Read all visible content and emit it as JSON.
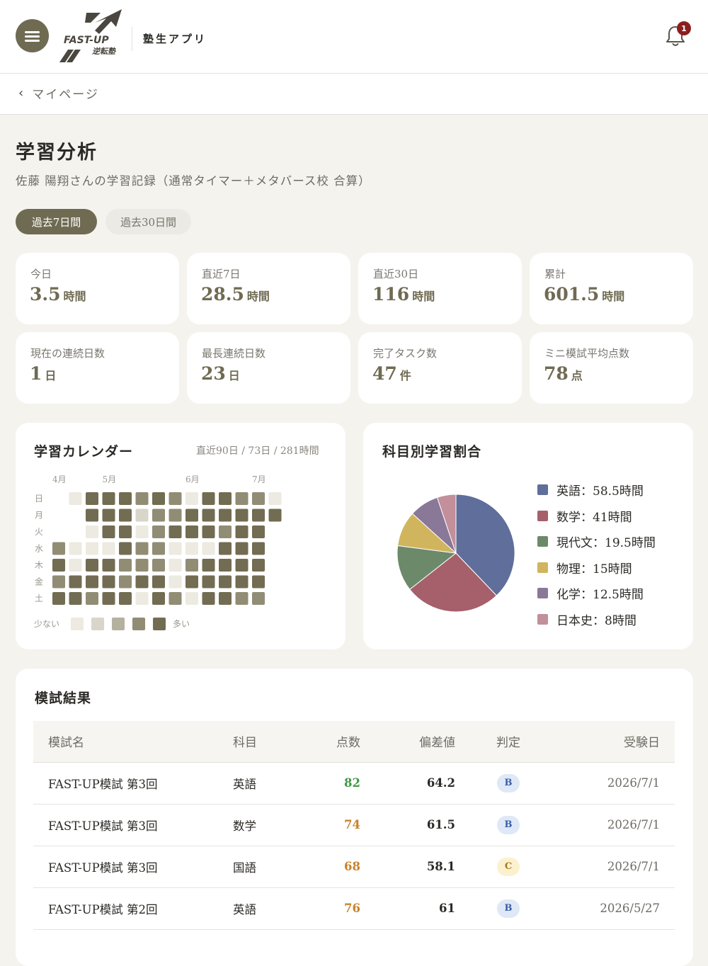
{
  "header": {
    "logo_text_1": "FAST-UP",
    "logo_text_2": "逆転塾",
    "app_name": "塾生アプリ",
    "notification_count": "1"
  },
  "nav": {
    "back_label": "マイページ"
  },
  "page": {
    "title": "学習分析",
    "subtitle": "佐藤 陽翔さんの学習記録（通常タイマー＋メタバース校 合算）"
  },
  "tabs": [
    {
      "label": "過去7日間",
      "active": true
    },
    {
      "label": "過去30日間",
      "active": false
    }
  ],
  "stats": [
    {
      "label": "今日",
      "value": "3.5",
      "unit": "時間"
    },
    {
      "label": "直近7日",
      "value": "28.5",
      "unit": "時間"
    },
    {
      "label": "直近30日",
      "value": "116",
      "unit": "時間"
    },
    {
      "label": "累計",
      "value": "601.5",
      "unit": "時間"
    },
    {
      "label": "現在の連続日数",
      "value": "1",
      "unit": "日"
    },
    {
      "label": "最長連続日数",
      "value": "23",
      "unit": "日"
    },
    {
      "label": "完了タスク数",
      "value": "47",
      "unit": "件"
    },
    {
      "label": "ミニ模試平均点数",
      "value": "78",
      "unit": "点"
    }
  ],
  "calendar": {
    "title": "学習カレンダー",
    "summary": "直近90日 / 73日 / 281時間",
    "months": [
      "4月",
      "5月",
      "6月",
      "7月"
    ],
    "weekdays": [
      "日",
      "月",
      "火",
      "水",
      "木",
      "金",
      "土"
    ],
    "legend_less": "少ない",
    "legend_more": "多い",
    "colors": [
      "#eceae1",
      "#d8d6cb",
      "#b4b19f",
      "#918c74",
      "#726c52"
    ],
    "levels": [
      [
        -1,
        0,
        4,
        4,
        4,
        3,
        4,
        3,
        0,
        4,
        4,
        3,
        3,
        0
      ],
      [
        -1,
        -1,
        4,
        4,
        4,
        1,
        3,
        3,
        4,
        4,
        4,
        4,
        4,
        4
      ],
      [
        -1,
        -1,
        0,
        4,
        4,
        0,
        3,
        4,
        4,
        4,
        3,
        4,
        4,
        -1
      ],
      [
        3,
        0,
        0,
        0,
        4,
        3,
        3,
        0,
        0,
        0,
        4,
        4,
        4,
        -1
      ],
      [
        4,
        0,
        4,
        4,
        3,
        3,
        3,
        0,
        3,
        4,
        4,
        4,
        4,
        -1
      ],
      [
        3,
        4,
        4,
        4,
        3,
        4,
        4,
        0,
        4,
        4,
        4,
        4,
        4,
        -1
      ],
      [
        4,
        4,
        3,
        4,
        4,
        0,
        4,
        3,
        0,
        4,
        4,
        3,
        3,
        -1
      ]
    ]
  },
  "subjects": {
    "title": "科目別学習割合",
    "items": [
      {
        "label": "英語：58.5時間",
        "hours": 58.5,
        "color": "#5f6e9a"
      },
      {
        "label": "数学：41時間",
        "hours": 41,
        "color": "#a5606b"
      },
      {
        "label": "現代文：19.5時間",
        "hours": 19.5,
        "color": "#6c8a6a"
      },
      {
        "label": "物理：15時間",
        "hours": 15,
        "color": "#d1b55e"
      },
      {
        "label": "化学：12.5時間",
        "hours": 12.5,
        "color": "#8a7898"
      },
      {
        "label": "日本史：8時間",
        "hours": 8,
        "color": "#c28f9a"
      }
    ]
  },
  "results": {
    "title": "模試結果",
    "columns": [
      "模試名",
      "科目",
      "点数",
      "偏差値",
      "判定",
      "受験日"
    ],
    "rows": [
      {
        "name": "FAST-UP模試 第3回",
        "subject": "英語",
        "score": "82",
        "deviation": "64.2",
        "judge": "B",
        "date": "2026/7/1"
      },
      {
        "name": "FAST-UP模試 第3回",
        "subject": "数学",
        "score": "74",
        "deviation": "61.5",
        "judge": "B",
        "date": "2026/7/1"
      },
      {
        "name": "FAST-UP模試 第3回",
        "subject": "国語",
        "score": "68",
        "deviation": "58.1",
        "judge": "C",
        "date": "2026/7/1"
      },
      {
        "name": "FAST-UP模試 第2回",
        "subject": "英語",
        "score": "76",
        "deviation": "61",
        "judge": "B",
        "date": "2026/5/27"
      }
    ]
  }
}
